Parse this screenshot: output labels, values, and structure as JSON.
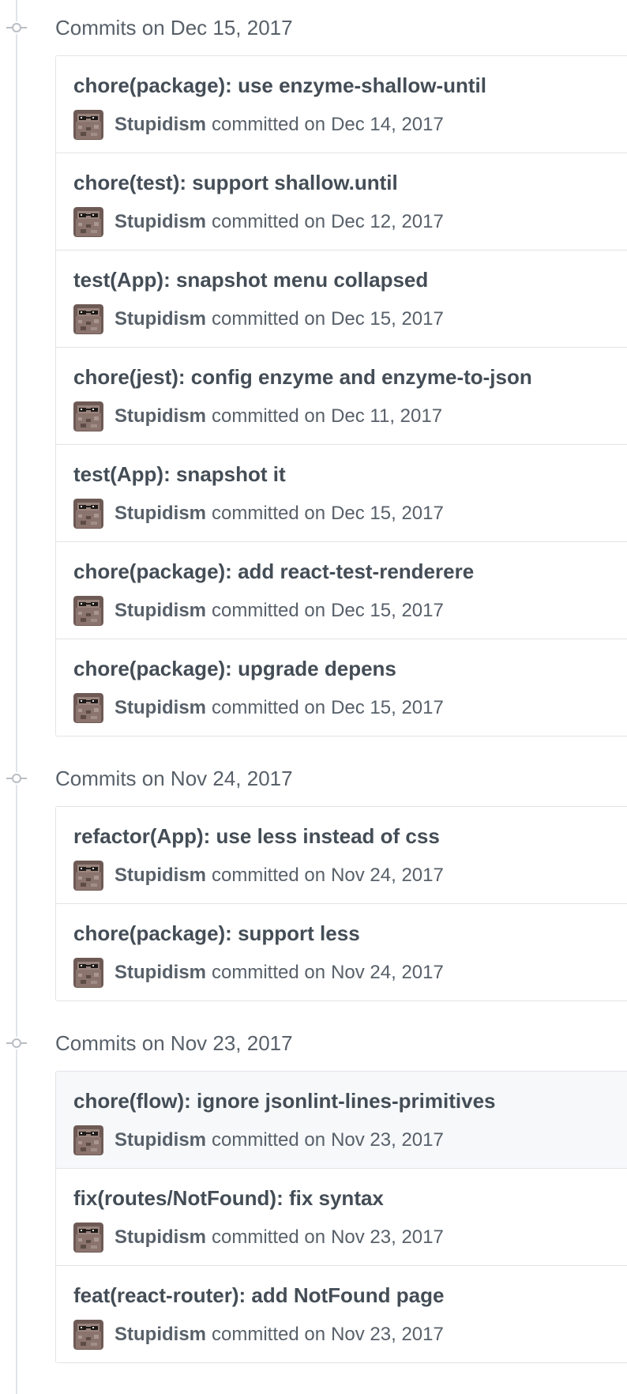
{
  "groups": [
    {
      "title": "Commits on Dec 15, 2017",
      "commits": [
        {
          "message": "chore(package): use enzyme-shallow-until",
          "author": "Stupidism",
          "verb": "committed on",
          "date": "Dec 14, 2017",
          "highlight": false
        },
        {
          "message": "chore(test): support shallow.until",
          "author": "Stupidism",
          "verb": "committed on",
          "date": "Dec 12, 2017",
          "highlight": false
        },
        {
          "message": "test(App): snapshot menu collapsed",
          "author": "Stupidism",
          "verb": "committed on",
          "date": "Dec 15, 2017",
          "highlight": false
        },
        {
          "message": "chore(jest): config enzyme and enzyme-to-json",
          "author": "Stupidism",
          "verb": "committed on",
          "date": "Dec 11, 2017",
          "highlight": false
        },
        {
          "message": "test(App): snapshot it",
          "author": "Stupidism",
          "verb": "committed on",
          "date": "Dec 15, 2017",
          "highlight": false
        },
        {
          "message": "chore(package): add react-test-renderere",
          "author": "Stupidism",
          "verb": "committed on",
          "date": "Dec 15, 2017",
          "highlight": false
        },
        {
          "message": "chore(package): upgrade depens",
          "author": "Stupidism",
          "verb": "committed on",
          "date": "Dec 15, 2017",
          "highlight": false
        }
      ]
    },
    {
      "title": "Commits on Nov 24, 2017",
      "commits": [
        {
          "message": "refactor(App): use less instead of css",
          "author": "Stupidism",
          "verb": "committed on",
          "date": "Nov 24, 2017",
          "highlight": false
        },
        {
          "message": "chore(package): support less",
          "author": "Stupidism",
          "verb": "committed on",
          "date": "Nov 24, 2017",
          "highlight": false
        }
      ]
    },
    {
      "title": "Commits on Nov 23, 2017",
      "commits": [
        {
          "message": "chore(flow): ignore jsonlint-lines-primitives",
          "author": "Stupidism",
          "verb": "committed on",
          "date": "Nov 23, 2017",
          "highlight": true
        },
        {
          "message": "fix(routes/NotFound): fix syntax",
          "author": "Stupidism",
          "verb": "committed on",
          "date": "Nov 23, 2017",
          "highlight": false
        },
        {
          "message": "feat(react-router): add NotFound page",
          "author": "Stupidism",
          "verb": "committed on",
          "date": "Nov 23, 2017",
          "highlight": false
        }
      ]
    }
  ],
  "icons": {
    "timeline_node": "git-commit-icon",
    "avatar": "user-avatar"
  },
  "colors": {
    "highlight_row": "#f6f8fa",
    "border": "#e1e4e8",
    "text_muted": "#586069",
    "text_title": "#444d56"
  }
}
